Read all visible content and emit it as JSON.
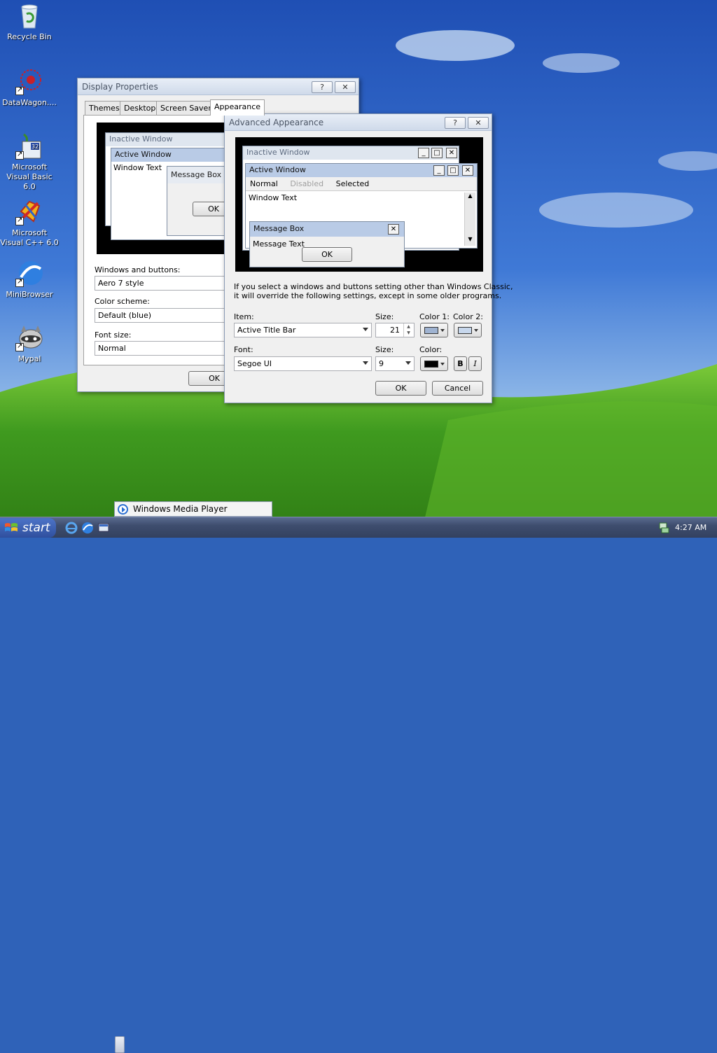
{
  "desktop": {
    "icons": [
      {
        "label": "Recycle Bin"
      },
      {
        "label": "DataWagon...."
      },
      {
        "label": "Microsoft\nVisual Basic 6.0",
        "line1": "Microsoft",
        "line2": "Visual Basic 6.0"
      },
      {
        "label": "Microsoft\nVisual C++ 6.0",
        "line1": "Microsoft",
        "line2": "Visual C++ 6.0"
      },
      {
        "label": "MiniBrowser"
      },
      {
        "label": "Mypal"
      }
    ]
  },
  "display_properties": {
    "title": "Display Properties",
    "help_glyph": "?",
    "close_glyph": "✕",
    "tabs": [
      "Themes",
      "Desktop",
      "Screen Saver",
      "Appearance"
    ],
    "active_tab": "Appearance",
    "preview": {
      "inactive": "Inactive Window",
      "active": "Active Window",
      "window_text": "Window Text",
      "message_box": "Message Box",
      "ok": "OK"
    },
    "windows_buttons_label": "Windows and buttons:",
    "windows_buttons_value": "Aero 7 style",
    "color_scheme_label": "Color scheme:",
    "color_scheme_value": "Default (blue)",
    "font_size_label": "Font size:",
    "font_size_value": "Normal",
    "ok": "OK"
  },
  "advanced": {
    "title": "Advanced Appearance",
    "help_glyph": "?",
    "close_glyph": "✕",
    "preview": {
      "inactive": "Inactive Window",
      "active": "Active Window",
      "normal": "Normal",
      "disabled": "Disabled",
      "selected": "Selected",
      "window_text": "Window Text",
      "message_box": "Message Box",
      "message_text": "Message Text",
      "ok": "OK"
    },
    "note_line1": "If you select a windows and buttons setting other than Windows Classic,",
    "note_line2": "it will override the following settings, except in some older programs.",
    "item_label": "Item:",
    "item_value": "Active Title Bar",
    "size_label": "Size:",
    "size_value": "21",
    "color1_label": "Color 1:",
    "color2_label": "Color 2:",
    "color1": "#9fb3d1",
    "color2": "#c7d7ec",
    "font_label": "Font:",
    "font_value": "Segoe UI",
    "font_size_label": "Size:",
    "font_size_value": "9",
    "font_color_label": "Color:",
    "font_color": "#000000",
    "bold": "B",
    "italic": "I",
    "ok": "OK",
    "cancel": "Cancel"
  },
  "taskbar": {
    "start": "start",
    "popup_label": "Windows Media Player",
    "clock": "4:27 AM"
  }
}
